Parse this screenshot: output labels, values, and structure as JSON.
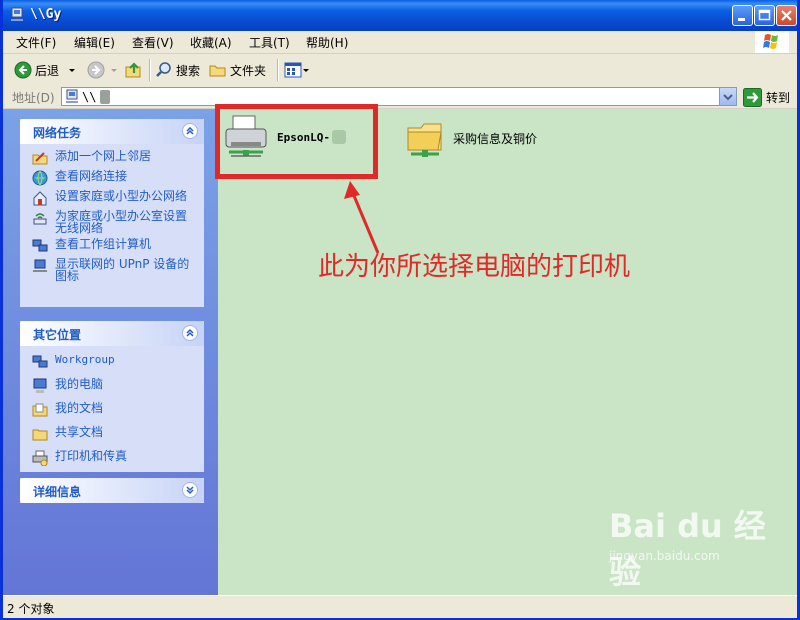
{
  "window": {
    "title": "\\\\Gy"
  },
  "menu": [
    {
      "label": "文件(F)"
    },
    {
      "label": "编辑(E)"
    },
    {
      "label": "查看(V)"
    },
    {
      "label": "收藏(A)"
    },
    {
      "label": "工具(T)"
    },
    {
      "label": "帮助(H)"
    }
  ],
  "toolbar": {
    "back_label": "后退",
    "search_label": "搜索",
    "folders_label": "文件夹"
  },
  "address": {
    "label": "地址(D)",
    "value": "\\\\",
    "go_label": "转到"
  },
  "sidebar": {
    "network_tasks": {
      "title": "网络任务",
      "items": [
        {
          "label": "添加一个网上邻居",
          "icon": "add-network-place-icon"
        },
        {
          "label": "查看网络连接",
          "icon": "network-connections-icon"
        },
        {
          "label": "设置家庭或小型办公网络",
          "icon": "home-network-setup-icon"
        },
        {
          "label": "为家庭或小型办公室设置无线网络",
          "icon": "wireless-network-icon"
        },
        {
          "label": "查看工作组计算机",
          "icon": "workgroup-computers-icon"
        },
        {
          "label": "显示联网的 UPnP 设备的图标",
          "icon": "upnp-devices-icon"
        }
      ]
    },
    "other_places": {
      "title": "其它位置",
      "items": [
        {
          "label": "Workgroup",
          "icon": "workgroup-icon"
        },
        {
          "label": "我的电脑",
          "icon": "my-computer-icon"
        },
        {
          "label": "我的文档",
          "icon": "my-documents-icon"
        },
        {
          "label": "共享文档",
          "icon": "shared-documents-icon"
        },
        {
          "label": "打印机和传真",
          "icon": "printers-faxes-icon"
        }
      ]
    },
    "details": {
      "title": "详细信息"
    }
  },
  "items": [
    {
      "label": "EpsonLQ-",
      "icon": "printer-icon"
    },
    {
      "label": "采购信息及铜价",
      "icon": "shared-folder-icon"
    }
  ],
  "annotation": {
    "text": "此为你所选择电脑的打印机",
    "color": "#e02a2a"
  },
  "status": {
    "text": "2 个对象"
  },
  "watermark": {
    "brand": "Bai du 经验",
    "url": "jingyan.baidu.com"
  }
}
